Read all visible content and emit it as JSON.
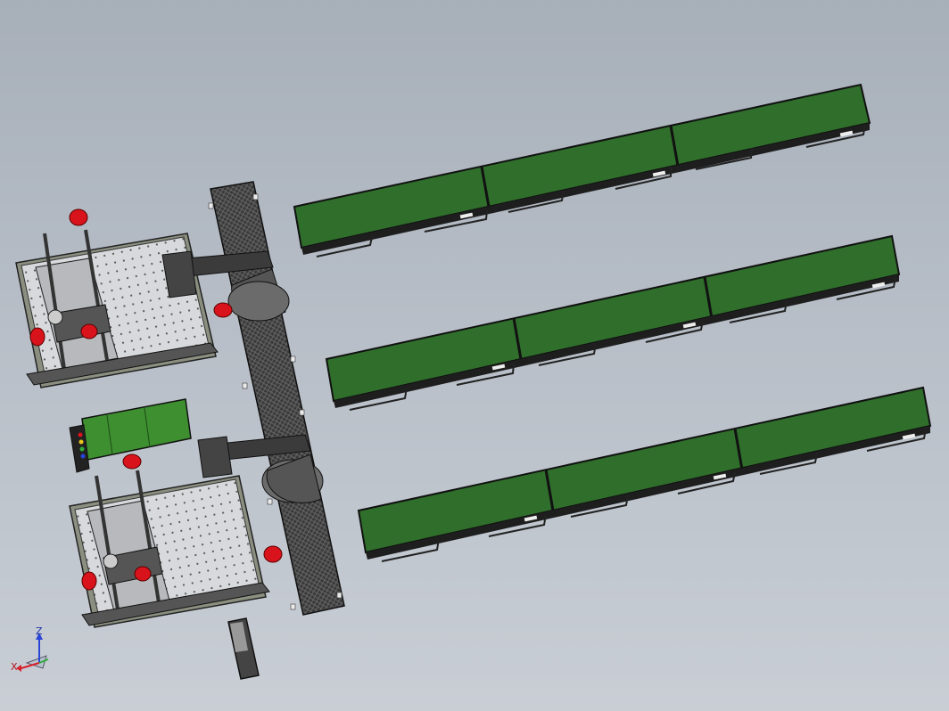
{
  "viewport": {
    "background_top": "#a7afb9",
    "background_bottom": "#c9ced5"
  },
  "colors": {
    "conveyor_belt": "#2f6e2b",
    "conveyor_belt_light": "#3f8a36",
    "frame_dark": "#2a2a2a",
    "red_accent": "#d9131b",
    "control_cabinet": "#3d8f2f",
    "axis_x": "#d8202a",
    "axis_y": "#2fae3a",
    "axis_z": "#2a44d8"
  },
  "model": {
    "conveyors": [
      "conveyor-line-1",
      "conveyor-line-2",
      "conveyor-line-3"
    ],
    "workstations": [
      "workstation-upper",
      "workstation-lower"
    ],
    "robots": [
      "robot-arm-upper",
      "robot-arm-lower"
    ],
    "robot_track": "robot-linear-track",
    "control_cabinet": "control-cabinet",
    "small_box": "tool-box"
  },
  "triad": {
    "x_label": "X",
    "z_label": "Z"
  }
}
